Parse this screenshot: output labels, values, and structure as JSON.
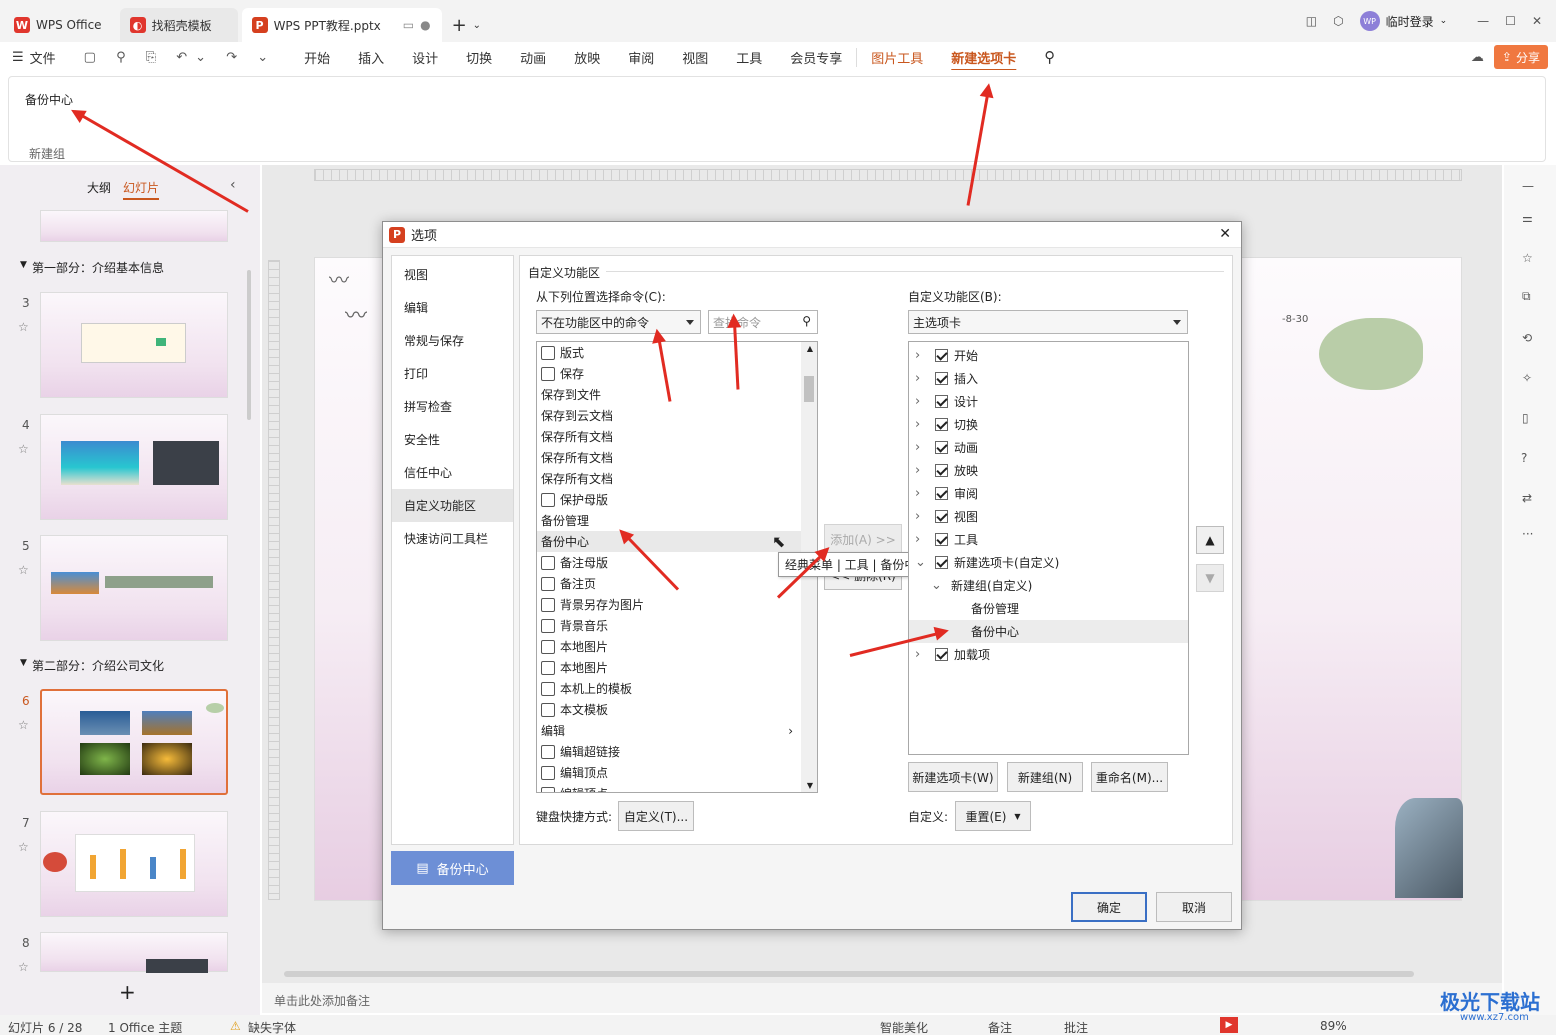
{
  "tabs": [
    {
      "label": "WPS Office"
    },
    {
      "label": "找稻壳模板"
    },
    {
      "label": "WPS PPT教程.pptx"
    }
  ],
  "titlebar": {
    "user": "临时登录",
    "avatar": "WP"
  },
  "menu": {
    "file": "文件",
    "items": [
      "开始",
      "插入",
      "设计",
      "切换",
      "动画",
      "放映",
      "审阅",
      "视图",
      "工具",
      "会员专享"
    ],
    "special": [
      "图片工具",
      "新建选项卡"
    ],
    "share": "分享"
  },
  "ribbon": {
    "item": "备份中心",
    "group": "新建组"
  },
  "leftpanel": {
    "outline": "大纲",
    "slides": "幻灯片",
    "section1": "第一部分：介绍基本信息",
    "section2": "第二部分：介绍公司文化",
    "add": "+"
  },
  "slides": [
    {
      "num": "3"
    },
    {
      "num": "4"
    },
    {
      "num": "5"
    },
    {
      "num": "6"
    },
    {
      "num": "7"
    },
    {
      "num": "8"
    }
  ],
  "notes_placeholder": "单击此处添加备注",
  "status": {
    "slide": "幻灯片 6 / 28",
    "theme": "1 Office 主题",
    "font_warning": "缺失字体",
    "beautify": "智能美化",
    "notes": "备注",
    "comments": "批注",
    "zoom": "89%"
  },
  "slide_date": "-8-30",
  "dialog": {
    "title": "选项",
    "close": "✕",
    "nav": [
      "视图",
      "编辑",
      "常规与保存",
      "打印",
      "拼写检查",
      "安全性",
      "信任中心",
      "自定义功能区",
      "快速访问工具栏"
    ],
    "section_title": "自定义功能区",
    "left_label": "从下列位置选择命令(C):",
    "left_combo": "不在功能区中的命令",
    "search_placeholder": "查找命令",
    "commands": [
      "版式",
      "保存",
      "保存到文件",
      "保存到云文档",
      "保存所有文档",
      "保存所有文档",
      "保存所有文档",
      "保护母版",
      "备份管理",
      "备份中心",
      "备注母版",
      "备注页",
      "背景另存为图片",
      "背景音乐",
      "本地图片",
      "本地图片",
      "本机上的模板",
      "本文模板",
      "编辑",
      "编辑超链接",
      "编辑顶点",
      "编辑顶点"
    ],
    "add_button": "添加(A) >>",
    "remove_button": "<< 删除(R)",
    "tooltip": "经典菜单 | 工具 | 备份中心",
    "right_label": "自定义功能区(B):",
    "right_combo": "主选项卡",
    "tree": [
      {
        "label": "开始"
      },
      {
        "label": "插入"
      },
      {
        "label": "设计"
      },
      {
        "label": "切换"
      },
      {
        "label": "动画"
      },
      {
        "label": "放映"
      },
      {
        "label": "审阅"
      },
      {
        "label": "视图"
      },
      {
        "label": "工具"
      },
      {
        "label": "新建选项卡(自定义)"
      },
      {
        "label": "新建组(自定义)"
      },
      {
        "label": "备份管理"
      },
      {
        "label": "备份中心"
      },
      {
        "label": "加载项"
      }
    ],
    "new_tab_btn": "新建选项卡(W)",
    "new_group_btn": "新建组(N)",
    "rename_btn": "重命名(M)...",
    "shortcut_label": "键盘快捷方式:",
    "shortcut_btn": "自定义(T)...",
    "custom_label": "自定义:",
    "reset_btn": "重置(E)",
    "backup_btn": "备份中心",
    "ok": "确定",
    "cancel": "取消"
  },
  "watermark": {
    "brand": "极光下载站",
    "url": "www.xz7.com"
  },
  "colors": {
    "accent": "#c9571e",
    "dialog_blue": "#6d8fd6",
    "arrow": "#e12b22"
  }
}
